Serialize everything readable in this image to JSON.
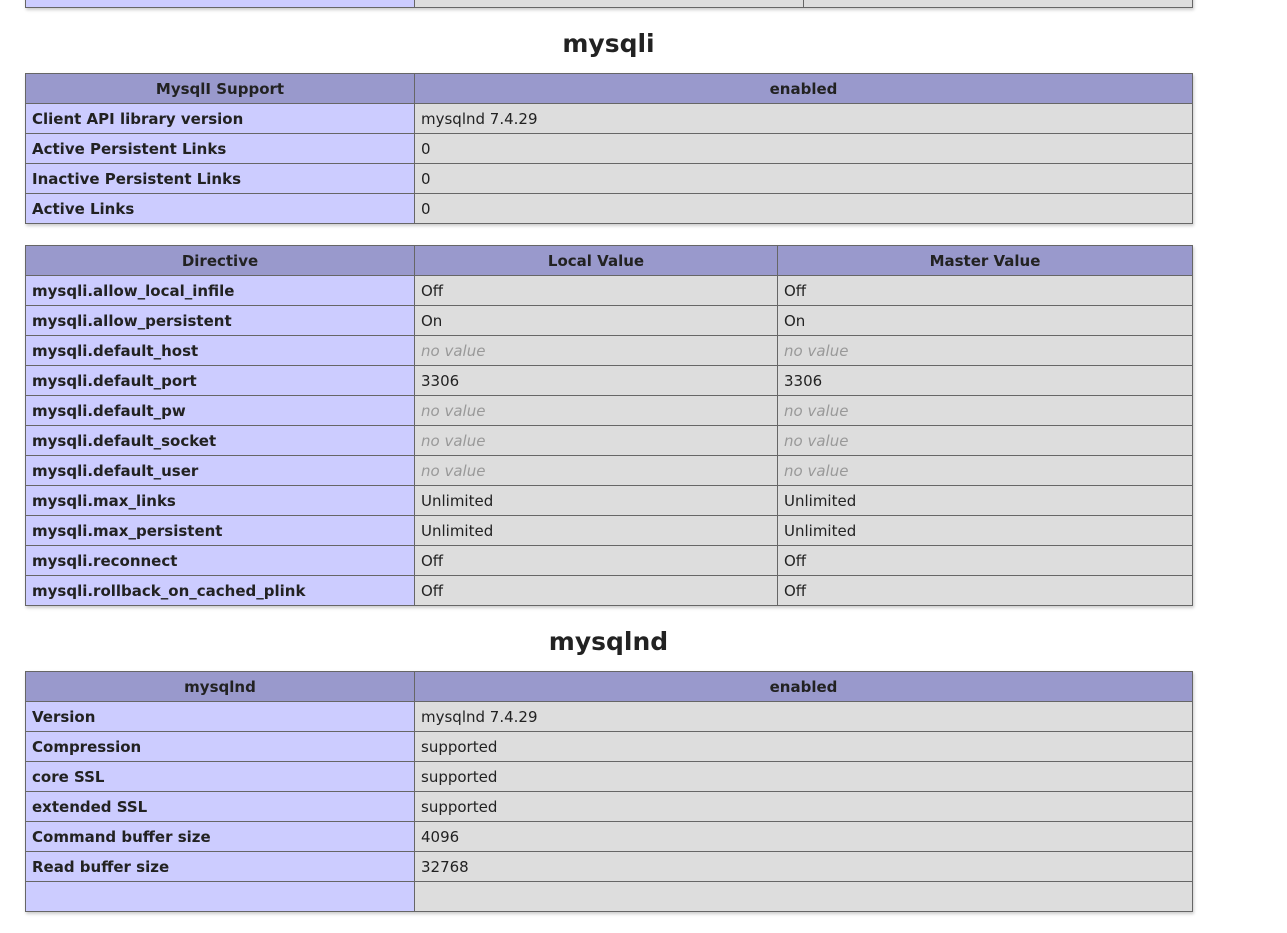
{
  "top_partial_row": {
    "cells": [
      "",
      "",
      ""
    ]
  },
  "mysqli": {
    "heading": "mysqli",
    "support_table": {
      "header": [
        "MysqlI Support",
        "enabled"
      ],
      "rows": [
        [
          "Client API library version",
          "mysqlnd 7.4.29"
        ],
        [
          "Active Persistent Links",
          "0"
        ],
        [
          "Inactive Persistent Links",
          "0"
        ],
        [
          "Active Links",
          "0"
        ]
      ]
    },
    "directive_table": {
      "header": [
        "Directive",
        "Local Value",
        "Master Value"
      ],
      "rows": [
        {
          "name": "mysqli.allow_local_infile",
          "local": "Off",
          "master": "Off",
          "novalue": false
        },
        {
          "name": "mysqli.allow_persistent",
          "local": "On",
          "master": "On",
          "novalue": false
        },
        {
          "name": "mysqli.default_host",
          "local": "no value",
          "master": "no value",
          "novalue": true
        },
        {
          "name": "mysqli.default_port",
          "local": "3306",
          "master": "3306",
          "novalue": false
        },
        {
          "name": "mysqli.default_pw",
          "local": "no value",
          "master": "no value",
          "novalue": true
        },
        {
          "name": "mysqli.default_socket",
          "local": "no value",
          "master": "no value",
          "novalue": true
        },
        {
          "name": "mysqli.default_user",
          "local": "no value",
          "master": "no value",
          "novalue": true
        },
        {
          "name": "mysqli.max_links",
          "local": "Unlimited",
          "master": "Unlimited",
          "novalue": false
        },
        {
          "name": "mysqli.max_persistent",
          "local": "Unlimited",
          "master": "Unlimited",
          "novalue": false
        },
        {
          "name": "mysqli.reconnect",
          "local": "Off",
          "master": "Off",
          "novalue": false
        },
        {
          "name": "mysqli.rollback_on_cached_plink",
          "local": "Off",
          "master": "Off",
          "novalue": false
        }
      ]
    }
  },
  "mysqlnd": {
    "heading": "mysqlnd",
    "table": {
      "header": [
        "mysqlnd",
        "enabled"
      ],
      "rows": [
        [
          "Version",
          "mysqlnd 7.4.29"
        ],
        [
          "Compression",
          "supported"
        ],
        [
          "core SSL",
          "supported"
        ],
        [
          "extended SSL",
          "supported"
        ],
        [
          "Command buffer size",
          "4096"
        ],
        [
          "Read buffer size",
          "32768"
        ],
        [
          "",
          ""
        ]
      ]
    }
  },
  "colors": {
    "header_bg": "#9999cc",
    "key_bg": "#ccccff",
    "value_bg": "#dddddd",
    "no_value_text": "#999999",
    "border": "#666666"
  }
}
